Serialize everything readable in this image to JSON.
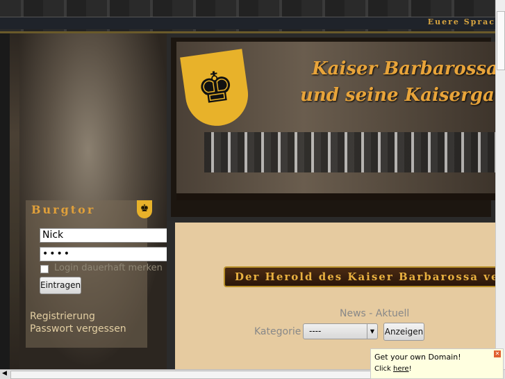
{
  "header": {
    "language_label": "Euere Sprac",
    "title_line1": "Kaiser Barbarossa",
    "title_line2": "und seine Kaisergarde"
  },
  "login": {
    "title": "Burgtor",
    "username": "Nick",
    "password": "••••",
    "remember_label": "Login dauerhaft merken",
    "submit": "Eintragen",
    "register": "Registrierung",
    "forgot": "Passwort vergessen"
  },
  "main": {
    "herold": "Der Herold des Kaiser Barbarossa verkünd",
    "news_title": "News - Aktuell",
    "category_label": "Kategorie",
    "category_value": "----",
    "show_button": "Anzeigen"
  },
  "popup": {
    "title": "Get your own Domain!",
    "click": "Click ",
    "link": "here",
    "suffix": "!"
  }
}
